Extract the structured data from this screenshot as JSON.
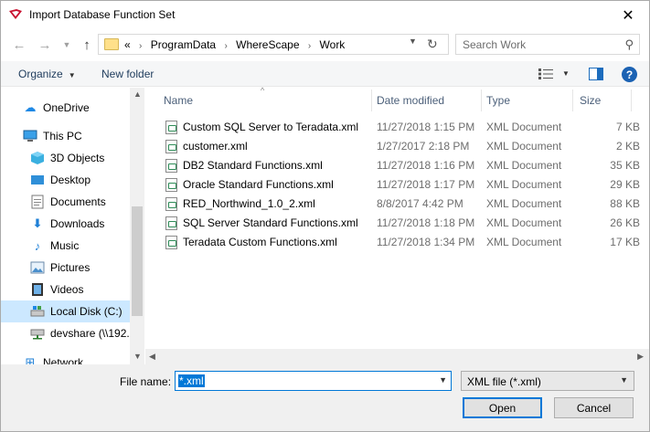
{
  "window": {
    "title": "Import Database Function Set"
  },
  "icons": {
    "app": "app-logo-icon",
    "close": "close-icon",
    "back": "back-arrow-icon",
    "forward": "forward-arrow-icon",
    "recent": "chevron-down-icon",
    "up": "up-arrow-icon",
    "folder": "folder-icon",
    "refresh": "refresh-icon",
    "search": "search-icon",
    "views": "view-options-icon",
    "preview": "preview-pane-icon",
    "help": "help-icon",
    "file": "xml-file-icon"
  },
  "address": {
    "prefix": "«",
    "crumbs": [
      "ProgramData",
      "WhereScape",
      "Work"
    ]
  },
  "search": {
    "placeholder": "Search Work"
  },
  "toolbar": {
    "organize": "Organize",
    "new_folder": "New folder"
  },
  "nav": {
    "items": [
      {
        "label": "OneDrive",
        "icon": "onedrive-icon"
      },
      {
        "label": "This PC",
        "icon": "this-pc-icon"
      },
      {
        "label": "3D Objects",
        "icon": "3d-objects-icon"
      },
      {
        "label": "Desktop",
        "icon": "desktop-icon"
      },
      {
        "label": "Documents",
        "icon": "documents-icon"
      },
      {
        "label": "Downloads",
        "icon": "downloads-icon"
      },
      {
        "label": "Music",
        "icon": "music-icon"
      },
      {
        "label": "Pictures",
        "icon": "pictures-icon"
      },
      {
        "label": "Videos",
        "icon": "videos-icon"
      },
      {
        "label": "Local Disk (C:)",
        "icon": "local-disk-icon"
      },
      {
        "label": "devshare (\\\\192.",
        "icon": "network-drive-icon"
      },
      {
        "label": "Network",
        "icon": "network-icon"
      }
    ]
  },
  "columns": {
    "name": "Name",
    "date": "Date modified",
    "type": "Type",
    "size": "Size"
  },
  "files": [
    {
      "name": "Custom SQL Server to Teradata.xml",
      "date": "11/27/2018 1:15 PM",
      "type": "XML Document",
      "size": "7 KB"
    },
    {
      "name": "customer.xml",
      "date": "1/27/2017 2:18 PM",
      "type": "XML Document",
      "size": "2 KB"
    },
    {
      "name": "DB2 Standard Functions.xml",
      "date": "11/27/2018 1:16 PM",
      "type": "XML Document",
      "size": "35 KB"
    },
    {
      "name": "Oracle Standard Functions.xml",
      "date": "11/27/2018 1:17 PM",
      "type": "XML Document",
      "size": "29 KB"
    },
    {
      "name": "RED_Northwind_1.0_2.xml",
      "date": "8/8/2017 4:42 PM",
      "type": "XML Document",
      "size": "88 KB"
    },
    {
      "name": "SQL Server Standard Functions.xml",
      "date": "11/27/2018 1:18 PM",
      "type": "XML Document",
      "size": "26 KB"
    },
    {
      "name": "Teradata Custom Functions.xml",
      "date": "11/27/2018 1:34 PM",
      "type": "XML Document",
      "size": "17 KB"
    }
  ],
  "footer": {
    "file_name_label": "File name:",
    "file_name_value": "*.xml",
    "file_type": "XML file (*.xml)",
    "open": "Open",
    "cancel": "Cancel"
  }
}
